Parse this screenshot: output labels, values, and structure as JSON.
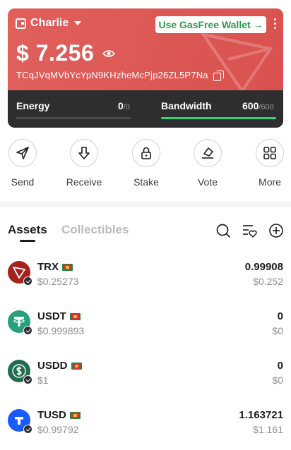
{
  "wallet": {
    "name": "Charlie",
    "gasfree_label": "Use GasFree Wallet →",
    "balance": "$ 7.256",
    "address": "TCqJVqMVbYcYpN9KHzheMcPjp26ZL5P7Na"
  },
  "resources": {
    "energy": {
      "label": "Energy",
      "used": "0",
      "total": "/0",
      "fill": 0
    },
    "bandwidth": {
      "label": "Bandwidth",
      "used": "600",
      "total": "/600",
      "fill": 1
    }
  },
  "actions": [
    {
      "label": "Send",
      "icon": "send-icon"
    },
    {
      "label": "Receive",
      "icon": "receive-icon"
    },
    {
      "label": "Stake",
      "icon": "lock-icon"
    },
    {
      "label": "Vote",
      "icon": "vote-icon"
    },
    {
      "label": "More",
      "icon": "grid-icon"
    }
  ],
  "tabs": {
    "assets": "Assets",
    "collectibles": "Collectibles"
  },
  "assets": [
    {
      "symbol": "TRX",
      "price": "$0.25273",
      "amount": "0.99908",
      "value": "$0.252",
      "color": "#a6211b"
    },
    {
      "symbol": "USDT",
      "price": "$0.999893",
      "amount": "0",
      "value": "$0",
      "color": "#26a17b"
    },
    {
      "symbol": "USDD",
      "price": "$1",
      "amount": "0",
      "value": "$0",
      "color": "#216e4f"
    },
    {
      "symbol": "TUSD",
      "price": "$0.99792",
      "amount": "1.163721",
      "value": "$1.161",
      "color": "#1a5aff"
    }
  ]
}
